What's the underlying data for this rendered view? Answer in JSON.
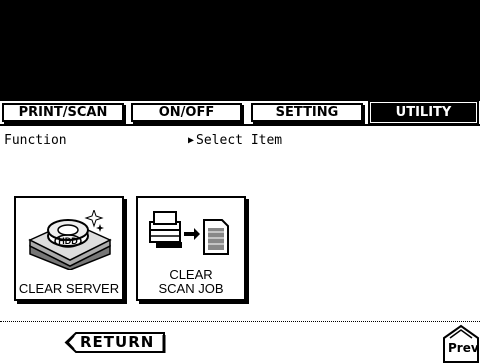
{
  "tabs": [
    {
      "label": "PRINT/SCAN",
      "active": false
    },
    {
      "label": "ON/OFF",
      "active": false
    },
    {
      "label": "SETTING",
      "active": false
    },
    {
      "label": "UTILITY",
      "active": true
    }
  ],
  "header": {
    "function_label": "Function",
    "select_item_label": "Select Item"
  },
  "function_buttons": [
    {
      "label": "CLEAR SERVER",
      "icon": "hdd-clear-icon"
    },
    {
      "label_line1": "CLEAR",
      "label_line2": "SCAN JOB",
      "icon": "scan-job-clear-icon"
    }
  ],
  "footer": {
    "return_label": "RETURN",
    "prev_label": "Prev"
  }
}
